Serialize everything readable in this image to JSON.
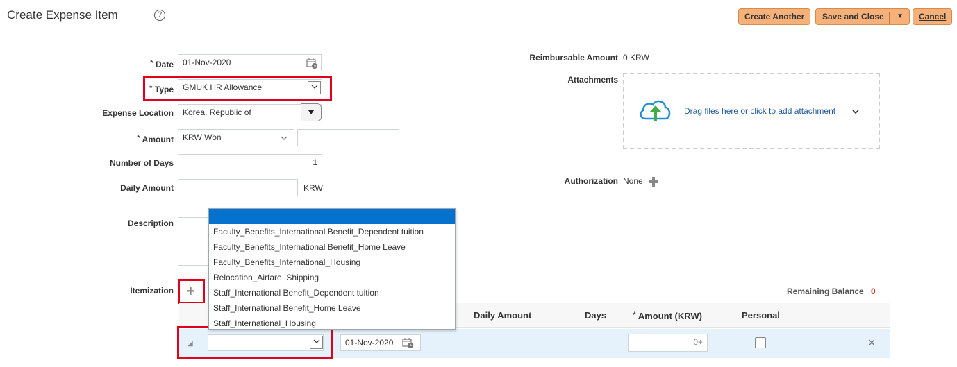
{
  "header": {
    "title": "Create Expense Item",
    "help_symbol": "?",
    "buttons": {
      "create_another": "Create Another",
      "save_and_close": "Save and Close",
      "save_menu_arrow": "▼",
      "cancel": "Cancel"
    }
  },
  "form": {
    "date": {
      "label": "Date",
      "required": "*",
      "value": "01-Nov-2020"
    },
    "type": {
      "label": "Type",
      "required": "*",
      "value": "GMUK HR Allowance"
    },
    "expense_location": {
      "label": "Expense Location",
      "value": "Korea, Republic of"
    },
    "amount": {
      "label": "Amount",
      "required": "*",
      "currency": "KRW Won",
      "value": ""
    },
    "number_of_days": {
      "label": "Number of Days",
      "value": "1"
    },
    "daily_amount": {
      "label": "Daily Amount",
      "value": "",
      "unit": "KRW"
    },
    "description": {
      "label": "Description",
      "value": ""
    },
    "itemization": {
      "label": "Itemization",
      "add_symbol": "+"
    }
  },
  "right_panel": {
    "reimbursable": {
      "label": "Reimbursable Amount",
      "value": "0 KRW"
    },
    "attachments": {
      "label": "Attachments",
      "drop_text": "Drag files here or click to add attachment"
    },
    "authorization": {
      "label": "Authorization",
      "value": "None"
    }
  },
  "type_dropdown": {
    "options": [
      "Faculty_Benefits_International Benefit_Dependent tuition",
      "Faculty_Benefits_International Benefit_Home Leave",
      "Faculty_Benefits_International_Housing",
      "Relocation_Airfare, Shipping",
      "Staff_International Benefit_Dependent tuition",
      "Staff_International Benefit_Home Leave",
      "Staff_International_Housing"
    ]
  },
  "itemization_table": {
    "remaining_balance_label": "Remaining Balance",
    "remaining_balance_value": "0",
    "columns": {
      "daily_amount": "Daily Amount",
      "days": "Days",
      "amount_required": "*",
      "amount": "Amount (KRW)",
      "personal": "Personal"
    },
    "row": {
      "type": "",
      "date": "01-Nov-2020",
      "amount": "0+",
      "personal": false
    },
    "close_symbol": "×",
    "expand_symbol": "◢"
  },
  "colors": {
    "button_orange": "#f6b07a",
    "highlight_red": "#e0001b",
    "selected_blue": "#0572ce",
    "link_blue": "#1f5b9c",
    "upload_green": "#3fae49",
    "remaining_balance": "#c0392b"
  }
}
